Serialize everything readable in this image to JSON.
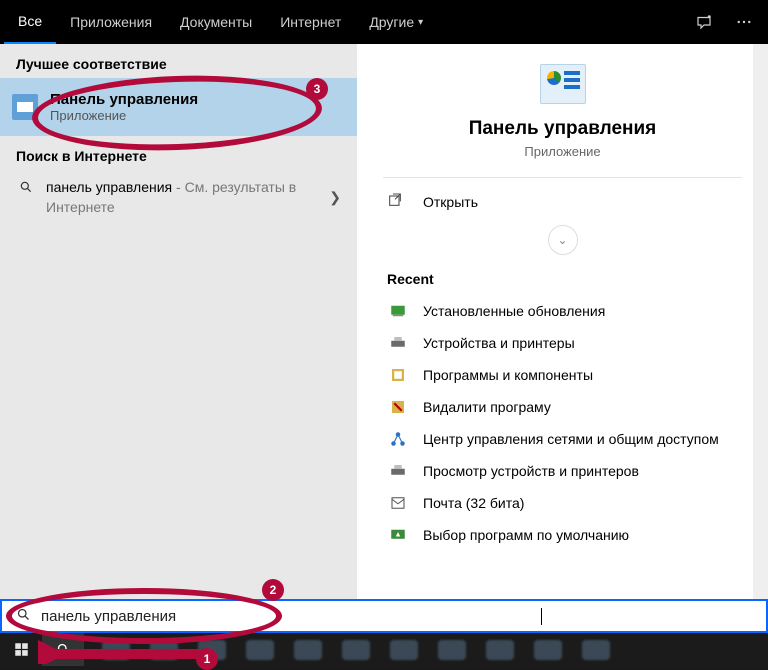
{
  "tabs": {
    "all": "Все",
    "apps": "Приложения",
    "docs": "Документы",
    "web": "Интернет",
    "more": "Другие"
  },
  "left": {
    "best_header": "Лучшее соответствие",
    "best_title": "Панель управления",
    "best_sub": "Приложение",
    "web_header": "Поиск в Интернете",
    "web_query": "панель управления",
    "web_suffix": " - См. результаты в Интернете"
  },
  "right": {
    "title": "Панель управления",
    "sub": "Приложение",
    "open": "Открыть",
    "recent_header": "Recent",
    "recent": [
      "Установленные обновления",
      "Устройства и принтеры",
      "Программы и компоненты",
      "Видалити програму",
      "Центр управления сетями и общим доступом",
      "Просмотр устройств и принтеров",
      "Почта (32 бита)",
      "Выбор программ по умолчанию"
    ]
  },
  "search": {
    "value": "панель управления"
  },
  "annotations": {
    "n1": "1",
    "n2": "2",
    "n3": "3"
  }
}
